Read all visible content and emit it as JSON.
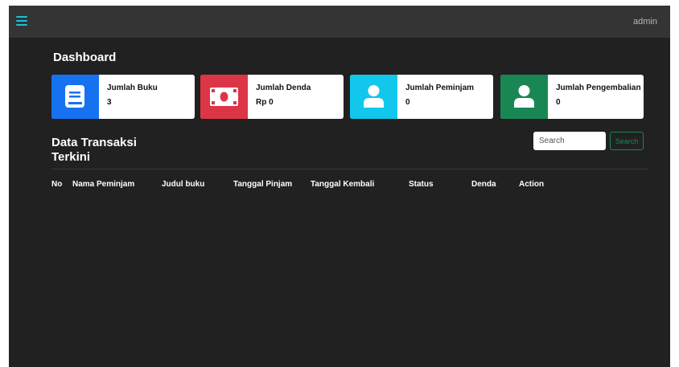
{
  "header": {
    "user": "admin"
  },
  "dashboard": {
    "title": "Dashboard"
  },
  "cards": [
    {
      "label": "Jumlah Buku",
      "value": "3",
      "color": "#1672f1",
      "icon": "book-icon"
    },
    {
      "label": "Jumlah Denda",
      "value": "Rp 0",
      "color": "#dc3545",
      "icon": "money-icon"
    },
    {
      "label": "Jumlah Peminjam",
      "value": "0",
      "color": "#12c7ec",
      "icon": "user-icon"
    },
    {
      "label": "Jumlah Pengembalian",
      "value": "0",
      "color": "#198754",
      "icon": "user-icon"
    }
  ],
  "transactions": {
    "title": "Data Transaksi Terkini",
    "search_placeholder": "Search",
    "search_button": "Search",
    "columns": [
      "No",
      "Nama Peminjam",
      "Judul buku",
      "Tanggal Pinjam",
      "Tanggal Kembali",
      "Status",
      "Denda",
      "Action"
    ],
    "rows": []
  },
  "colors": {
    "background": "#212121",
    "topbar": "#343434",
    "accent": "#19c0d6"
  }
}
